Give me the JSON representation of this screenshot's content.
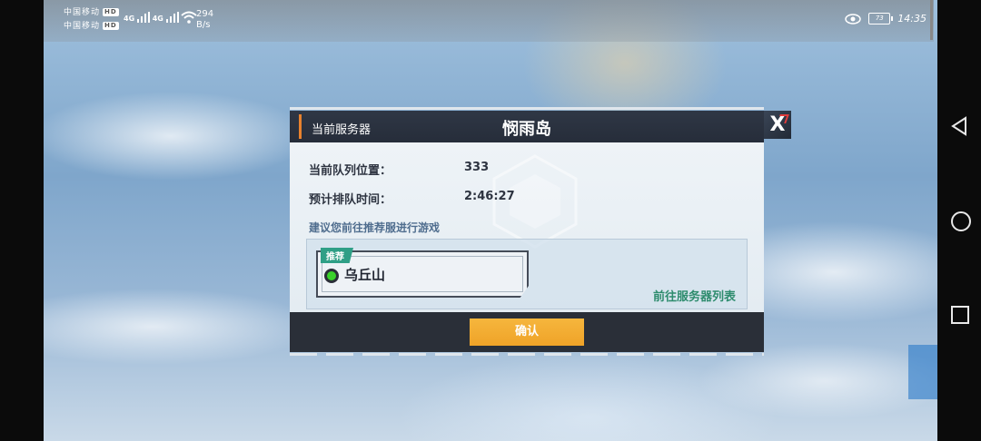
{
  "status_bar": {
    "sim1": "中国移动",
    "sim2": "中国移动",
    "hd": "HD",
    "network": "4G",
    "speed_value": "294",
    "speed_unit": "B/s",
    "battery": "73",
    "time": "14:35"
  },
  "dialog": {
    "current_server_label": "当前服务器",
    "server_name": "悯雨岛",
    "queue_position_label": "当前队列位置：",
    "queue_position_value": "333",
    "wait_time_label": "预计排队时间：",
    "wait_time_value": "2:46:27",
    "suggestion": "建议您前往推荐服进行游戏",
    "recommended_badge": "推荐",
    "recommended_server": "乌丘山",
    "goto_server_list": "前往服务器列表",
    "confirm": "确认",
    "close": "X"
  },
  "colors": {
    "accent": "#e8822e",
    "confirm_button": "#f2a92f",
    "link_green": "#2e8c6e",
    "status_dot": "#3ad12a"
  },
  "icons": [
    "wifi-icon",
    "signal-icon",
    "eye-icon",
    "battery-icon",
    "back-icon",
    "home-icon",
    "recents-icon",
    "close-icon"
  ]
}
